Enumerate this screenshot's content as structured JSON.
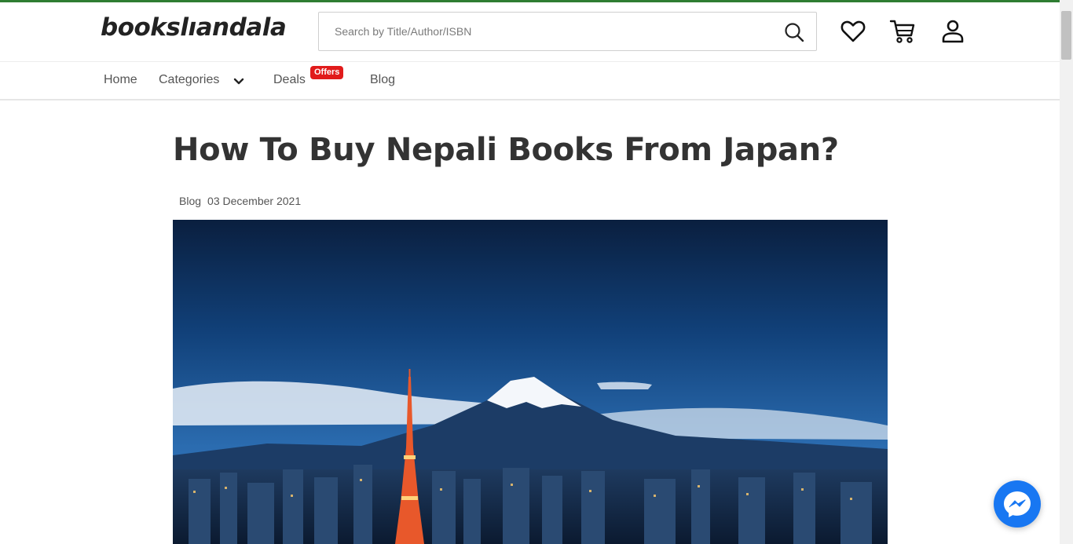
{
  "header": {
    "logo_text": "bookslıandala",
    "search_placeholder": "Search by Title/Author/ISBN",
    "icons": [
      "search-icon",
      "heart-icon",
      "cart-icon",
      "user-icon"
    ],
    "accent_color": "#2e7d32"
  },
  "nav": {
    "home": "Home",
    "categories": "Categories",
    "deals": "Deals",
    "offers_badge": "Offers",
    "blog": "Blog",
    "badge_color": "#e11b1b"
  },
  "article": {
    "title": "How To Buy Nepali Books From Japan?",
    "category": "Blog",
    "date": "03 December 2021"
  },
  "widgets": {
    "chat_icon": "messenger-icon",
    "chat_color": "#1877f2"
  }
}
